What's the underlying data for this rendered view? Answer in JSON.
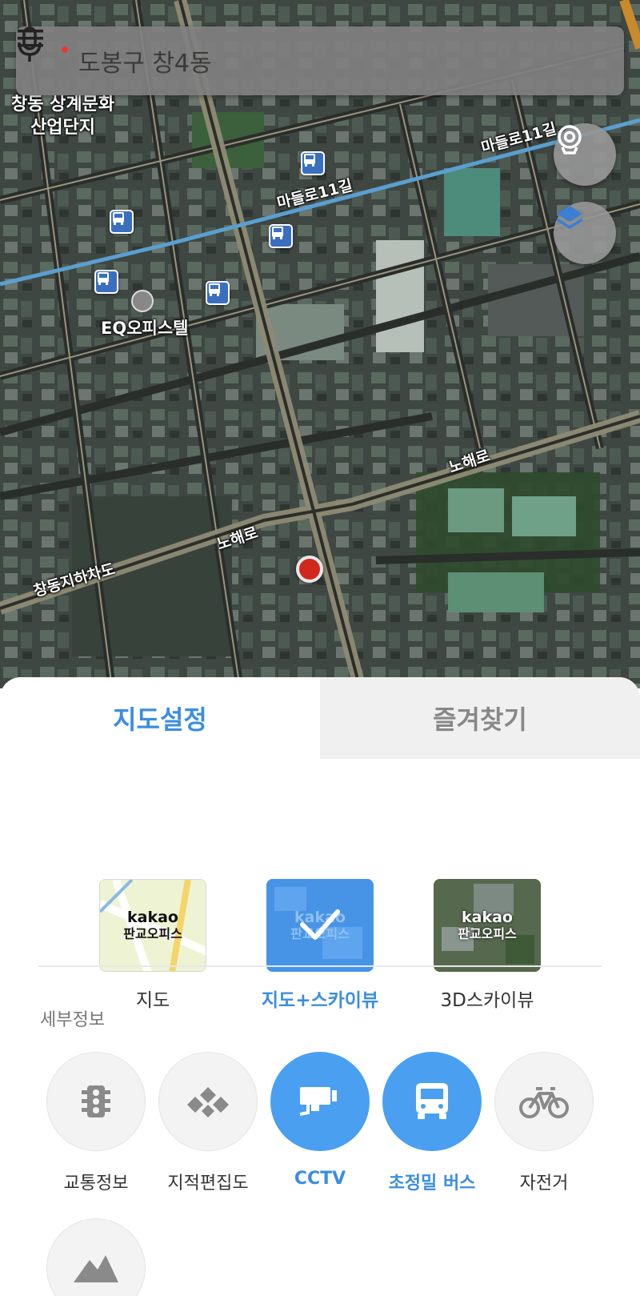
{
  "search": {
    "text": "도봉구 창4동"
  },
  "map": {
    "labels": {
      "district": "창동 상계문화\n산업단지",
      "building": "EQ오피스텔",
      "road_madeul_1": "마들로11길",
      "road_madeul_2": "마들로11길",
      "road_nohae_1": "노해로",
      "road_nohae_2": "노해로",
      "underpass": "창동지하차도"
    }
  },
  "sheet": {
    "tabs": [
      {
        "label": "지도설정",
        "active": true
      },
      {
        "label": "즐겨찾기",
        "active": false
      }
    ],
    "map_types": [
      {
        "label": "지도",
        "thumb_brand": "kakao",
        "thumb_sub": "판교오피스",
        "selected": false
      },
      {
        "label": "지도+스카이뷰",
        "thumb_brand": "kakao",
        "thumb_sub": "판교오피스",
        "selected": true
      },
      {
        "label": "3D스카이뷰",
        "thumb_brand": "kakao",
        "thumb_sub": "판교오피스",
        "selected": false
      }
    ],
    "section_title": "세부정보",
    "details": [
      {
        "label": "교통정보",
        "icon": "traffic-light-icon",
        "active": false
      },
      {
        "label": "지적편집도",
        "icon": "cadastral-map-icon",
        "active": false
      },
      {
        "label": "CCTV",
        "icon": "cctv-camera-icon",
        "active": true
      },
      {
        "label": "초정밀 버스",
        "icon": "bus-icon",
        "active": true
      },
      {
        "label": "자전거",
        "icon": "bicycle-icon",
        "active": false
      },
      {
        "label": "",
        "icon": "mountain-icon",
        "active": false
      }
    ]
  },
  "colors": {
    "accent": "#3b8ee0",
    "active_circle": "#4a9ff0",
    "inactive_icon": "#8a8a8a"
  }
}
